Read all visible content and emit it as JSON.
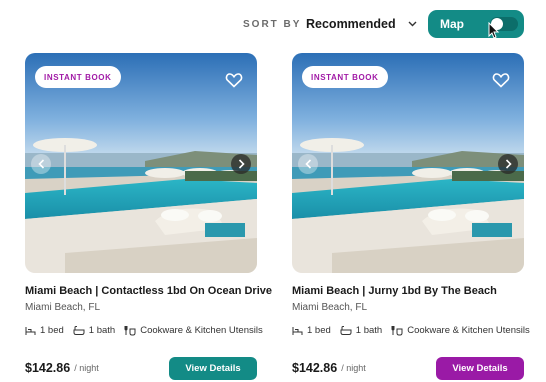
{
  "toolbar": {
    "sort_label": "SORT BY",
    "sort_value": "Recommended",
    "map_label": "Map"
  },
  "colors": {
    "teal": "#138b86",
    "purple": "#a11aa6",
    "badge_text": "#a11aa6"
  },
  "listings": [
    {
      "badge": "INSTANT BOOK",
      "title": "Miami Beach | Contactless 1bd On Ocean Drive",
      "location": "Miami Beach, FL",
      "beds": "1 bed",
      "baths": "1 bath",
      "amenity": "Cookware & Kitchen Utensils",
      "price": "$142.86",
      "per": "/ night",
      "cta": "View Details",
      "cta_color": "#138b86"
    },
    {
      "badge": "INSTANT BOOK",
      "title": "Miami Beach | Jurny 1bd By The Beach",
      "location": "Miami Beach, FL",
      "beds": "1 bed",
      "baths": "1 bath",
      "amenity": "Cookware & Kitchen Utensils",
      "price": "$142.86",
      "per": "/ night",
      "cta": "View Details",
      "cta_color": "#9a1aa6"
    }
  ]
}
